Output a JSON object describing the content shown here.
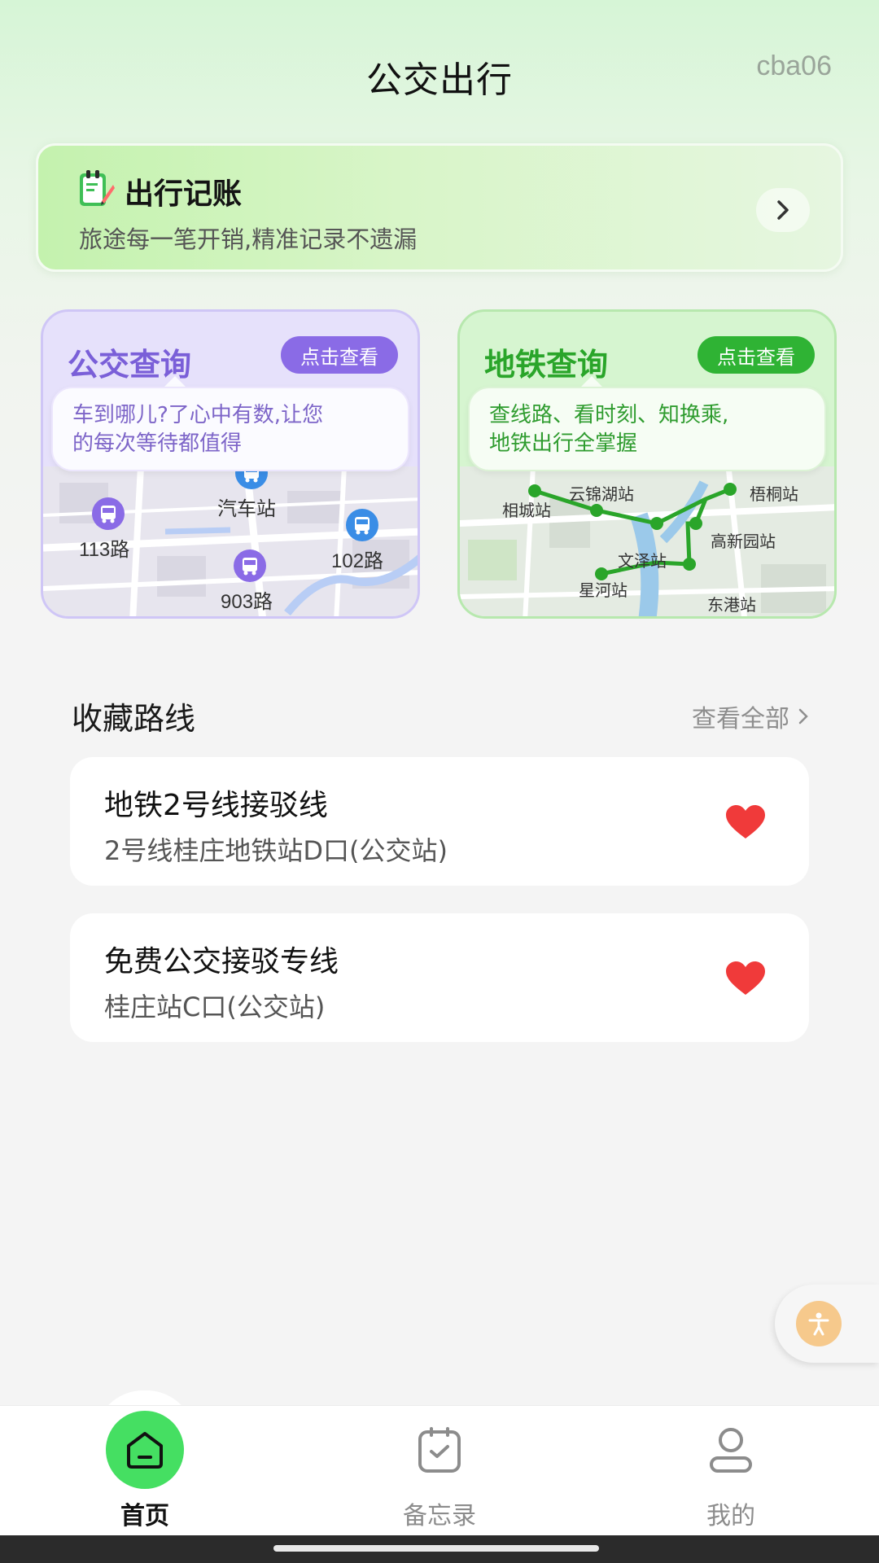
{
  "header": {
    "title": "公交出行",
    "watermark": "cba06"
  },
  "expense_card": {
    "title": "出行记账",
    "subtitle": "旅途每一笔开销,精准记录不遗漏",
    "icon": "notebook-pencil-icon"
  },
  "bus_card": {
    "title": "公交查询",
    "button": "点击查看",
    "desc_line1": "车到哪儿?了心中有数,让您",
    "desc_line2": "的每次等待都值得",
    "map_labels": [
      "汽车站",
      "113路",
      "102路",
      "903路"
    ],
    "accent": "#8a6be6"
  },
  "metro_card": {
    "title": "地铁查询",
    "button": "点击查看",
    "desc_line1": "查线路、看时刻、知换乘,",
    "desc_line2": "地铁出行全掌握",
    "stations": [
      "相城站",
      "云锦湖站",
      "梧桐站",
      "高新园站",
      "文泽站",
      "星河站",
      "东港站"
    ],
    "accent": "#2fb334"
  },
  "favorites": {
    "heading": "收藏路线",
    "view_all": "查看全部",
    "routes": [
      {
        "title": "地铁2号线接驳线",
        "subtitle": "2号线桂庄地铁站D口(公交站)"
      },
      {
        "title": "免费公交接驳专线",
        "subtitle": "桂庄站C口(公交站)"
      }
    ]
  },
  "nav": {
    "home": "首页",
    "memo": "备忘录",
    "mine": "我的"
  }
}
